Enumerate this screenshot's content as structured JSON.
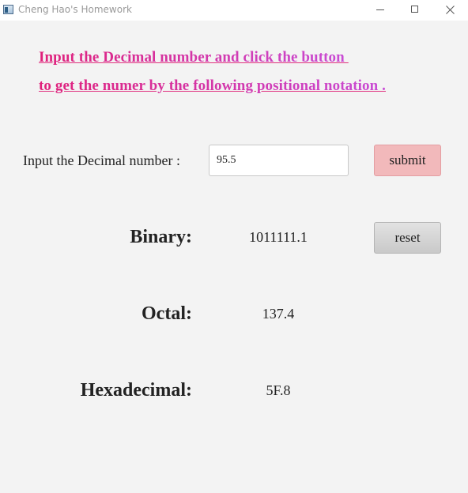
{
  "window": {
    "title": "Cheng Hao's Homework"
  },
  "heading": {
    "line1": "Input the Decimal number and click the button ",
    "line2": "to get the numer by the following positional notation ."
  },
  "input": {
    "label": "Input the Decimal number :",
    "value": "95.5"
  },
  "buttons": {
    "submit": "submit",
    "reset": "reset"
  },
  "results": {
    "binary_label": "Binary:",
    "binary_value": "1011111.1",
    "octal_label": "Octal:",
    "octal_value": "137.4",
    "hex_label": "Hexadecimal:",
    "hex_value": "5F.8"
  },
  "colors": {
    "heading_start": "#e0207a",
    "heading_end": "#c84bd6",
    "submit_bg": "#f2b9bb",
    "reset_bg": "#d4d4d4",
    "background": "#f3f3f3"
  }
}
